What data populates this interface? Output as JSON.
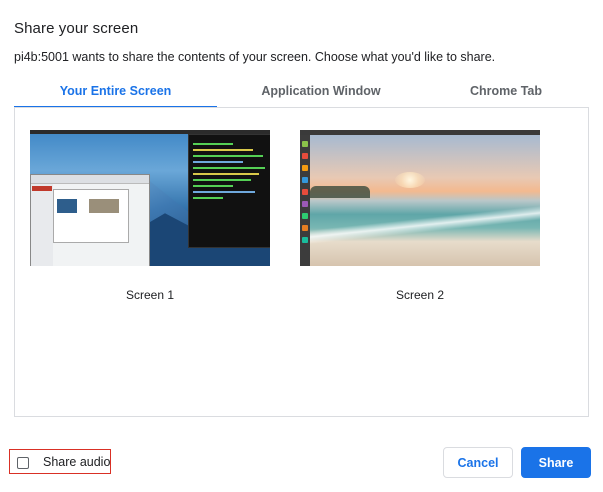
{
  "dialog": {
    "title": "Share your screen",
    "description": "pi4b:5001 wants to share the contents of your screen. Choose what you'd like to share."
  },
  "tabs": [
    {
      "label": "Your Entire Screen",
      "active": true
    },
    {
      "label": "Application Window",
      "active": false
    },
    {
      "label": "Chrome Tab",
      "active": false
    }
  ],
  "screens": [
    {
      "label": "Screen 1"
    },
    {
      "label": "Screen 2"
    }
  ],
  "footer": {
    "share_audio_label": "Share audio",
    "share_audio_checked": false,
    "cancel_label": "Cancel",
    "share_label": "Share"
  },
  "colors": {
    "accent": "#1a73e8",
    "highlight_border": "#d93025"
  }
}
